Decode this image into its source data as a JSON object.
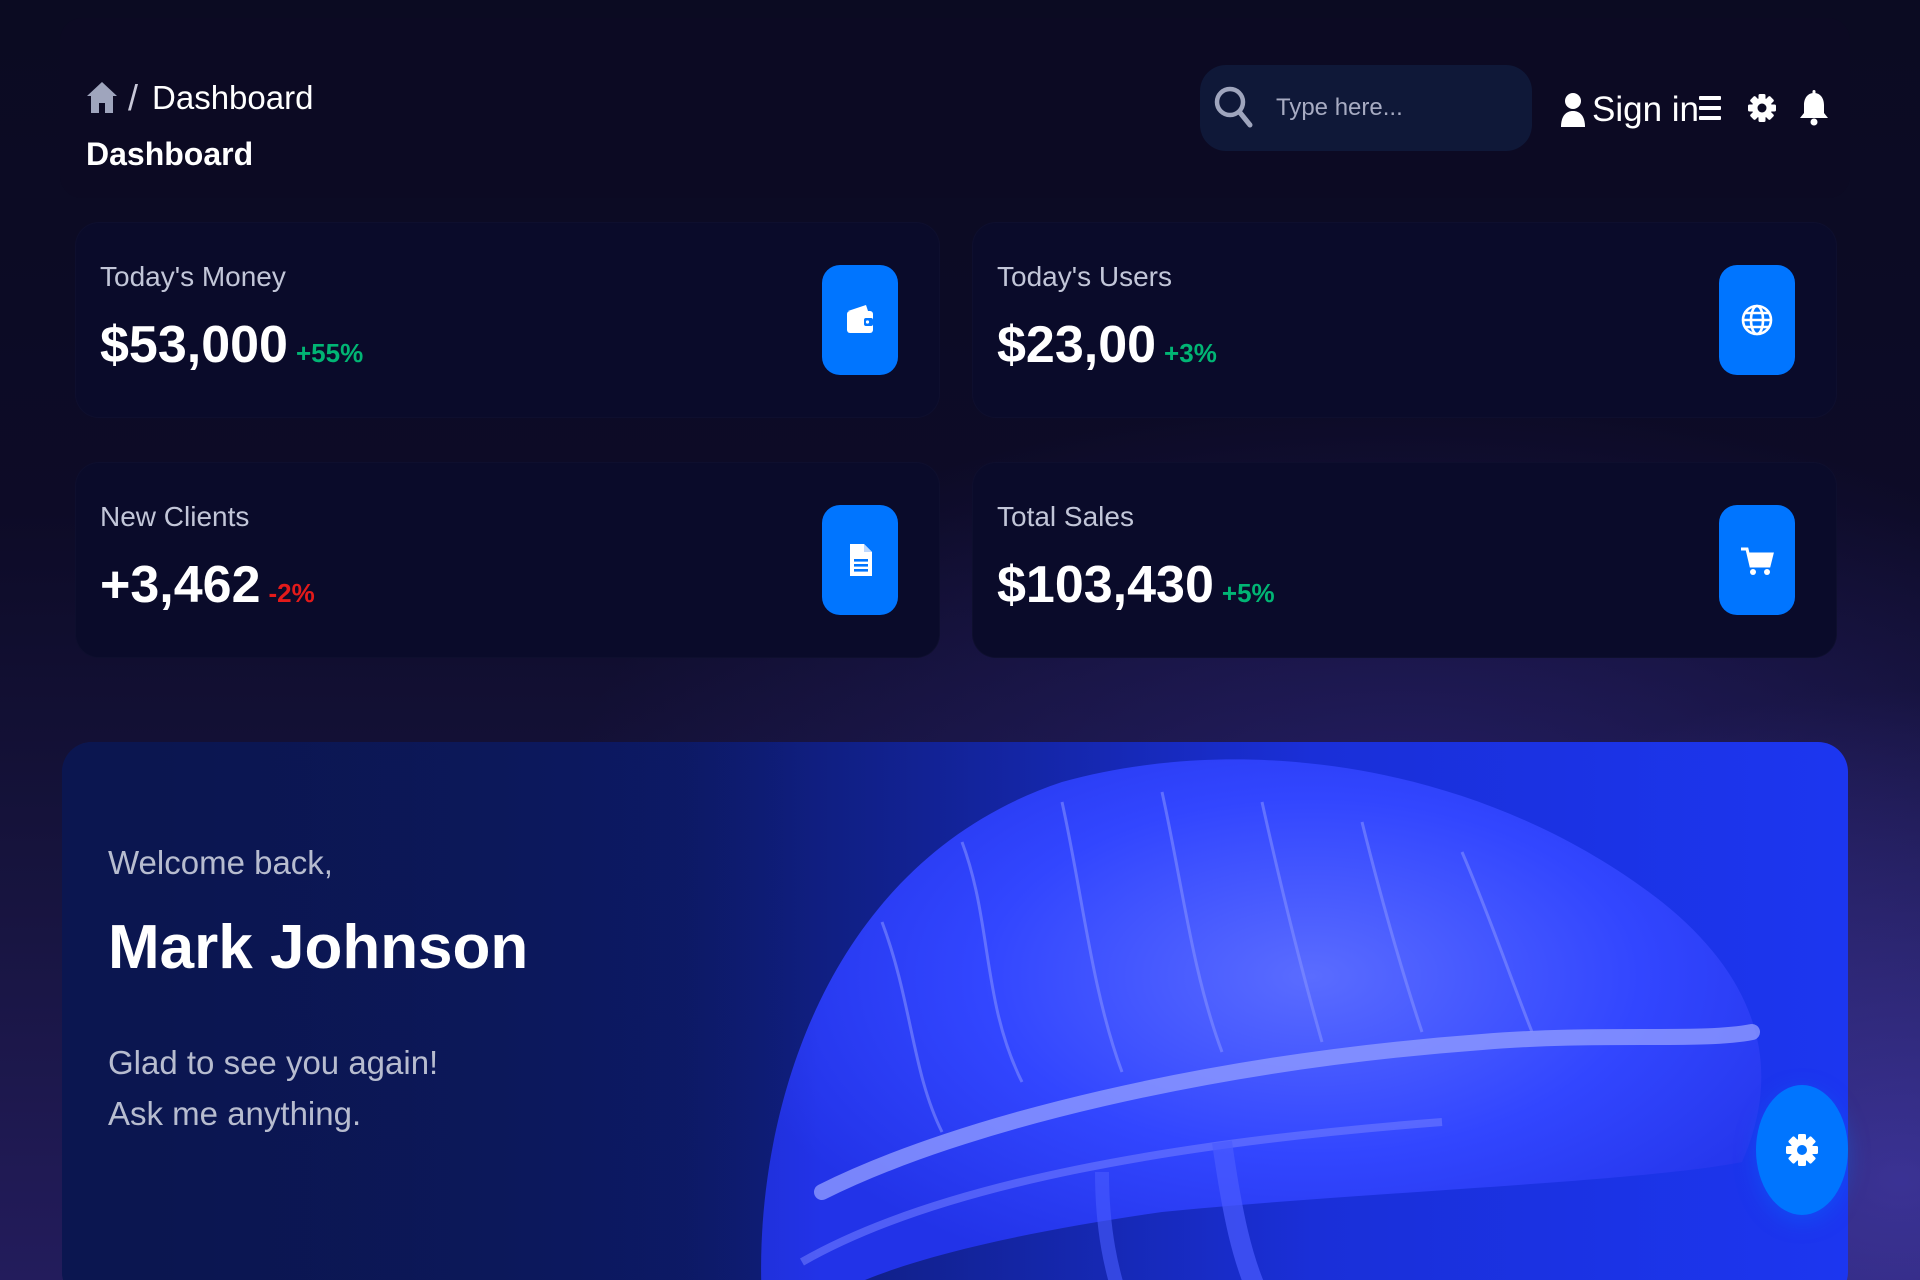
{
  "header": {
    "breadcrumb_current": "Dashboard",
    "breadcrumb_separator": "/",
    "page_title": "Dashboard",
    "search_placeholder": "Type here...",
    "signin_label": "Sign in"
  },
  "cards": [
    {
      "label": "Today's Money",
      "value": "$53,000",
      "change": "+55%",
      "trend": "positive",
      "icon": "wallet-icon"
    },
    {
      "label": "Today's Users",
      "value": "$23,00",
      "change": "+3%",
      "trend": "positive",
      "icon": "globe-icon"
    },
    {
      "label": "New Clients",
      "value": "+3,462",
      "change": "-2%",
      "trend": "negative",
      "icon": "document-icon"
    },
    {
      "label": "Total Sales",
      "value": "$103,430",
      "change": "+5%",
      "trend": "positive",
      "icon": "cart-icon"
    }
  ],
  "welcome": {
    "greeting": "Welcome back,",
    "name": "Mark Johnson",
    "line1": "Glad to see you again!",
    "line2": "Ask me anything."
  },
  "colors": {
    "accent": "#0075ff",
    "positive": "#01b574",
    "negative": "#e31a1a",
    "card_bg": "#0a0b2a"
  },
  "icons": {
    "breadcrumb": "home-icon",
    "search": "search-icon",
    "user": "user-icon",
    "menu": "hamburger-menu-icon",
    "settings": "gear-icon",
    "notifications": "bell-icon",
    "fab": "gear-icon"
  }
}
